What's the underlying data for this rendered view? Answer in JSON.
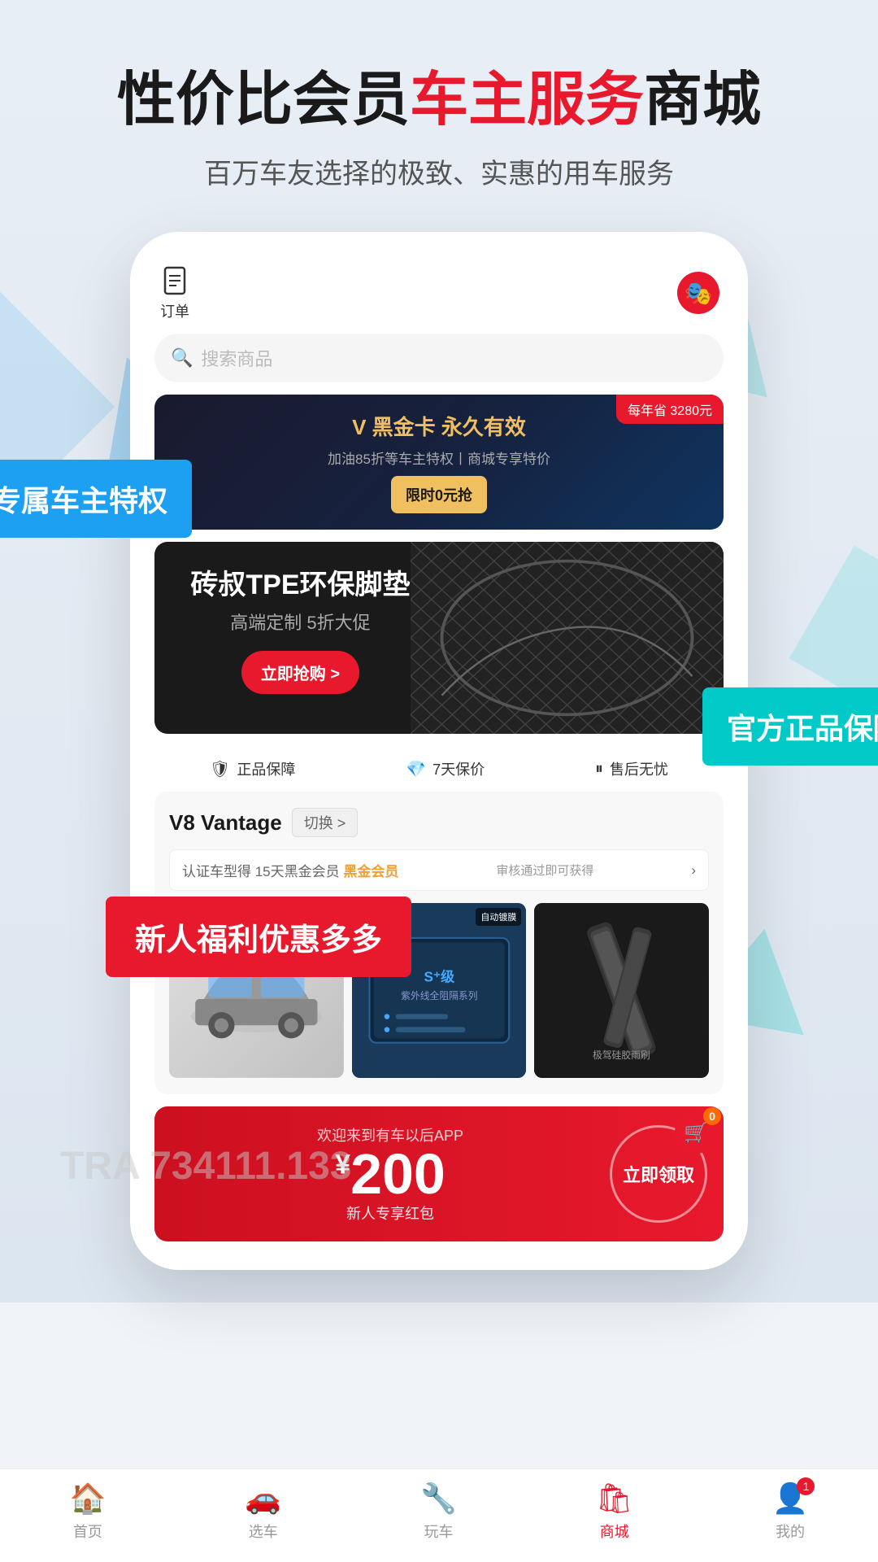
{
  "hero": {
    "title_black1": "性价比会员",
    "title_red": "车主服务",
    "title_black2": "商城",
    "subtitle": "百万车友选择的极致、实惠的用车服务"
  },
  "badges": {
    "left": "专属车主特权",
    "right": "官方正品保障",
    "bottom_left": "新人福利优惠多多"
  },
  "app": {
    "header": {
      "order_label": "订单",
      "avatar_emoji": "🎭"
    },
    "search": {
      "placeholder": "搜索商品"
    },
    "black_card": {
      "save_tag": "每年省 3280元",
      "title": "V 黑金卡  永久有效",
      "subtitle": "加油85折等车主特权丨商城专享特价",
      "cta": "限时0元抢"
    },
    "product_banner": {
      "title": "砖叔TPE环保脚垫",
      "subtitle": "高端定制 5折大促",
      "cta": "立即抢购 >",
      "dots": "● ● ●"
    },
    "features": [
      {
        "icon": "🛡",
        "label": "正品保障"
      },
      {
        "icon": "💎",
        "label": "7天保价"
      },
      {
        "icon": "⏸",
        "label": "售后无忧"
      }
    ],
    "car_model": {
      "name": "V8 Vantage",
      "switch_label": "切换 >",
      "member_notice": "认证车型得 15天黑金会员",
      "member_sub": "审核通过即可获得",
      "auto_badge": "自动镀膜",
      "products": [
        {
          "type": "car",
          "label": "轿车"
        },
        {
          "type": "film",
          "label": "S⁺级 紫外线全阻隔系列"
        },
        {
          "type": "wiper",
          "label": "极驾硅胶雨刷"
        }
      ]
    },
    "new_user": {
      "welcome": "欢迎来到有车以后APP",
      "amount": "200",
      "yuan_sign": "¥",
      "caption": "新人专享红包",
      "claim": "立即领取"
    }
  },
  "bottom_nav": {
    "items": [
      {
        "icon": "🏠",
        "label": "首页",
        "active": false
      },
      {
        "icon": "🚗",
        "label": "选车",
        "active": false
      },
      {
        "icon": "🔧",
        "label": "玩车",
        "active": false
      },
      {
        "icon": "🛍",
        "label": "商城",
        "active": true
      },
      {
        "icon": "👤",
        "label": "我的",
        "active": false,
        "badge": "1"
      }
    ]
  },
  "tra_watermark": "TRA 734111.133"
}
